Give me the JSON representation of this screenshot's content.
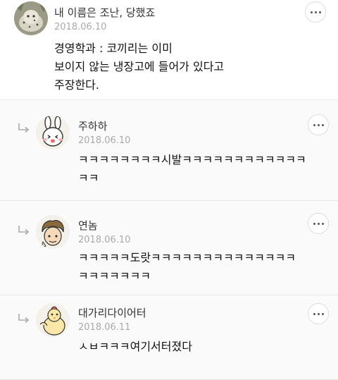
{
  "comments": [
    {
      "author": "내 이름은 조난, 당했죠",
      "date": "2018.06.10",
      "lines": [
        "경영학과 : 코끼리는 이미",
        "보이지 않는 냉장고에 들어가 있다고",
        "주장한다."
      ],
      "avatar_icon": "snow-leopard-avatar-icon"
    }
  ],
  "replies": [
    {
      "author": "주하하",
      "date": "2018.06.10",
      "lines": [
        "ㅋㅋㅋㅋㅋㅋㅋㅋ시발ㅋㅋㅋㅋㅋㅋㅋㅋㅋㅋㅋㅋ",
        "ㅋㅋ"
      ],
      "avatar_icon": "rabbit-avatar-icon"
    },
    {
      "author": "연놈",
      "date": "2018.06.10",
      "lines": [
        "ㅋㅋㅋㅋㅋ도랏ㅋㅋㅋㅋㅋㅋㅋㅋㅋㅋㅋㅋㅋㅋ",
        "ㅋㅋㅋㅋㅋㅋㅋ"
      ],
      "avatar_icon": "curly-hair-avatar-icon"
    },
    {
      "author": "대가리다이어터",
      "date": "2018.06.11",
      "lines": [
        "ㅅㅂㅋㅋㅋ여기서터졌다"
      ],
      "avatar_icon": "chick-avatar-icon"
    }
  ],
  "colors": {
    "background": "#ffffff",
    "reply_background": "#fafafa",
    "date_text": "#aaaaaa",
    "divider": "#e6e6e6"
  },
  "icons": {
    "reply_indicator": "reply-arrow-icon",
    "more_options": "more-options-icon"
  }
}
